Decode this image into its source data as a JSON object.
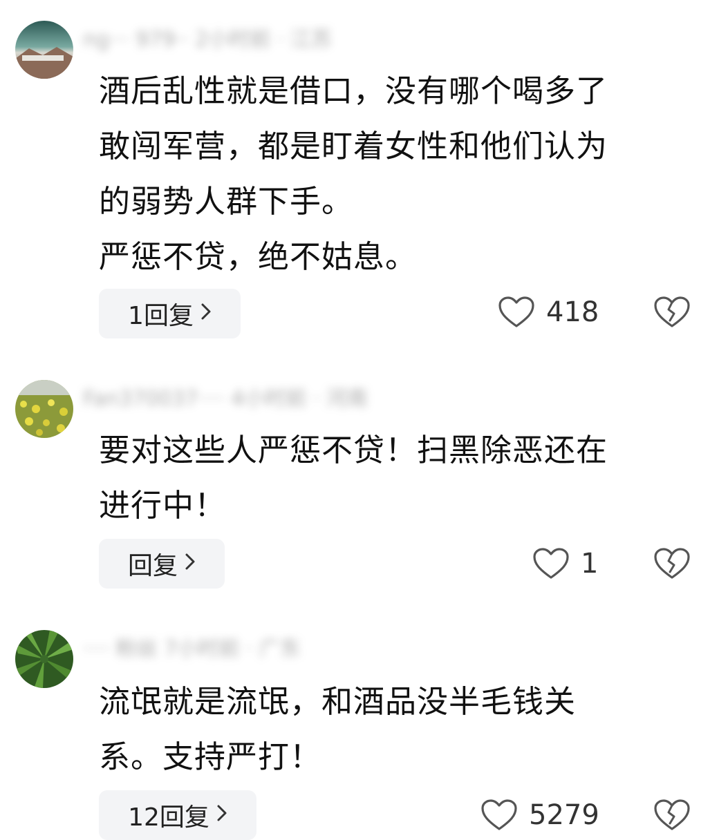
{
  "comments": [
    {
      "meta_blurred": "ng··· 979·· 2小时前 · 江苏",
      "lines": [
        "酒后乱性就是借口，没有哪个喝多了",
        "敢闯军营，都是盯着女性和他们认为",
        "的弱势人群下手。",
        "严惩不贷，绝不姑息。"
      ],
      "reply_label": "1回复",
      "likes": "418"
    },
    {
      "meta_blurred": "Fan370037···· 4小时前 · 河南",
      "lines": [
        "要对这些人严惩不贷！扫黑除恶还在",
        "进行中！"
      ],
      "reply_label": "回复",
      "likes": "1"
    },
    {
      "meta_blurred": "···· 粉丝 7小时前 · 广东",
      "lines": [
        "流氓就是流氓，和酒品没半毛钱关",
        "系。支持严打！"
      ],
      "reply_label": "12回复",
      "likes": "5279"
    }
  ],
  "icons": {
    "like": "heart-outline-icon",
    "dislike": "broken-heart-icon",
    "reply_chevron": "chevron-right-icon"
  },
  "colors": {
    "reply_bg": "#f3f4f6",
    "text": "#111111",
    "icon": "#555555"
  }
}
